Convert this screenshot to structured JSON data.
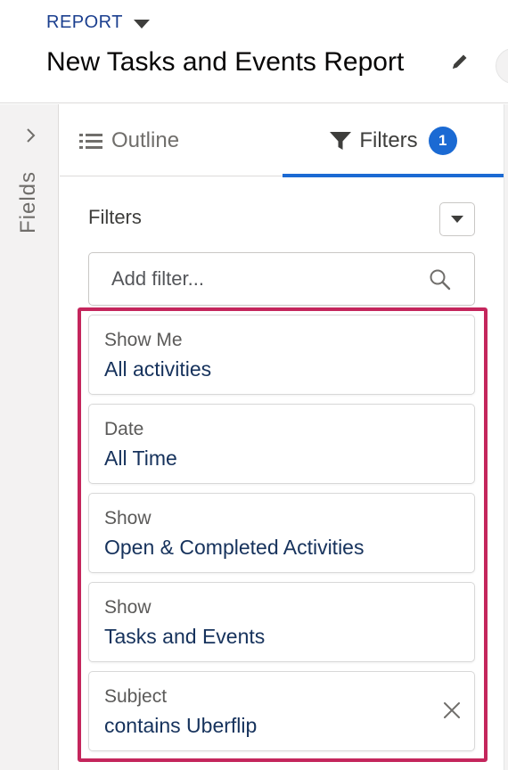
{
  "header": {
    "report_type_label": "REPORT",
    "title": "New Tasks and Events Report"
  },
  "fields_rail": {
    "label": "Fields"
  },
  "tabs": [
    {
      "label": "Outline",
      "icon": "list-icon",
      "active": false
    },
    {
      "label": "Filters",
      "icon": "funnel-icon",
      "active": true,
      "badge": "1"
    }
  ],
  "filters_panel": {
    "heading": "Filters",
    "add_filter_placeholder": "Add filter...",
    "items": [
      {
        "label": "Show Me",
        "value": "All activities",
        "removable": false
      },
      {
        "label": "Date",
        "value": "All Time",
        "removable": false
      },
      {
        "label": "Show",
        "value": "Open & Completed Activities",
        "removable": false
      },
      {
        "label": "Show",
        "value": "Tasks and Events",
        "removable": false
      },
      {
        "label": "Subject",
        "value": "contains Uberflip",
        "removable": true
      }
    ]
  },
  "colors": {
    "brand_blue": "#1b6ad3",
    "highlight": "#c4265c",
    "value_text": "#16325c"
  }
}
